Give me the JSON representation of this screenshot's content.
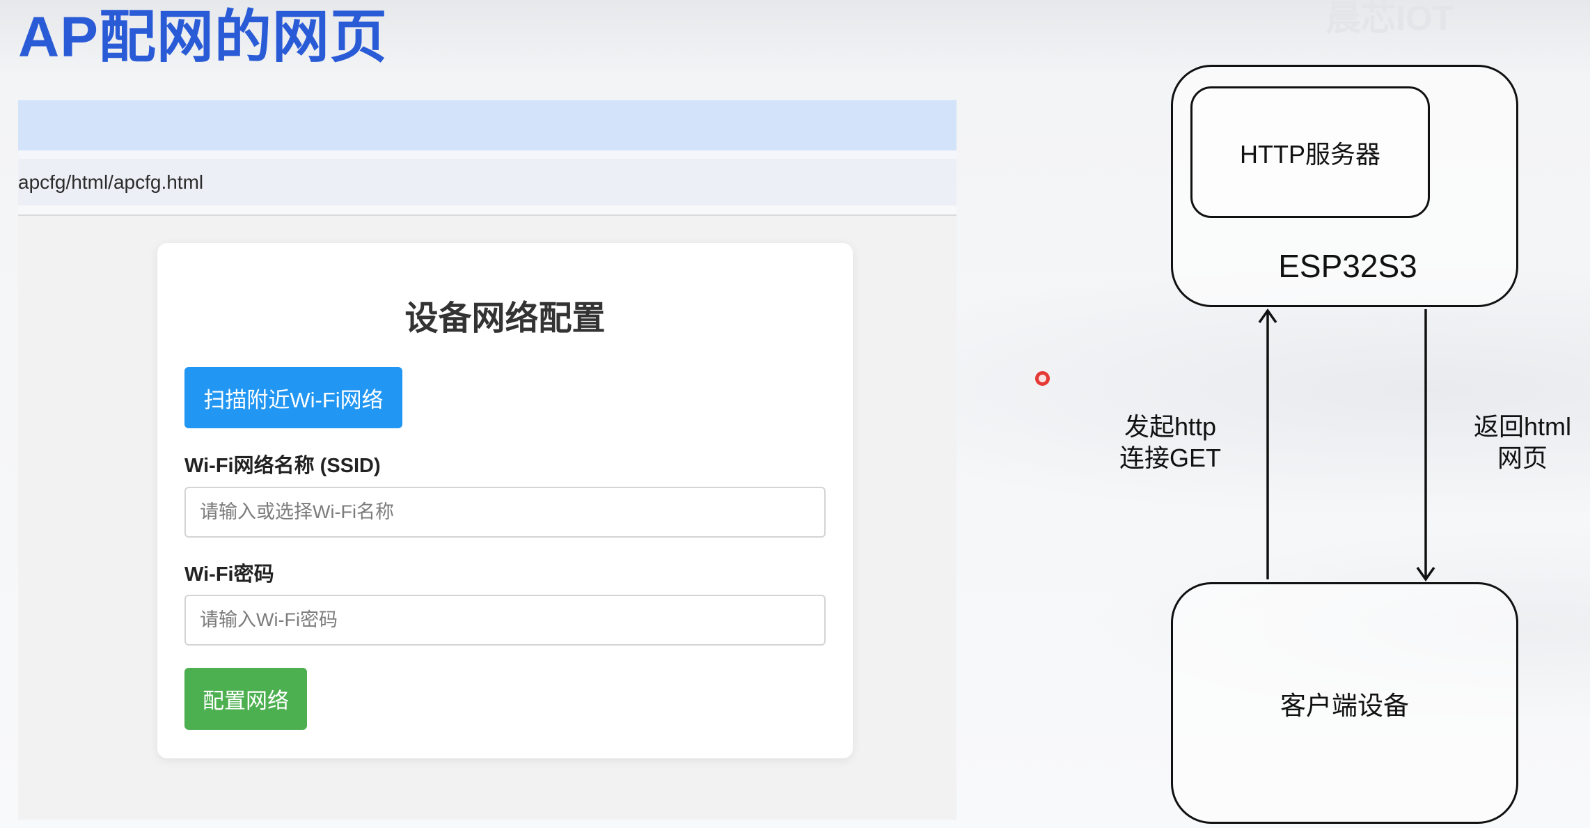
{
  "slide": {
    "title": "AP配网的网页",
    "watermark": "晨芯IOT"
  },
  "browser": {
    "url": "apcfg/html/apcfg.html"
  },
  "form": {
    "heading": "设备网络配置",
    "scan_button": "扫描附近Wi-Fi网络",
    "ssid_label": "Wi-Fi网络名称 (SSID)",
    "ssid_placeholder": "请输入或选择Wi-Fi名称",
    "password_label": "Wi-Fi密码",
    "password_placeholder": "请输入Wi-Fi密码",
    "submit_button": "配置网络"
  },
  "diagram": {
    "server_label": "HTTP服务器",
    "device_label": "ESP32S3",
    "client_label": "客户端设备",
    "request_label": [
      "发起http",
      "连接GET"
    ],
    "response_label": [
      "返回html",
      "网页"
    ]
  },
  "colors": {
    "title": "#2a5bd7",
    "browser_bar": "#d2e3fa",
    "scan_button": "#2196f3",
    "submit_button": "#4caf50"
  }
}
